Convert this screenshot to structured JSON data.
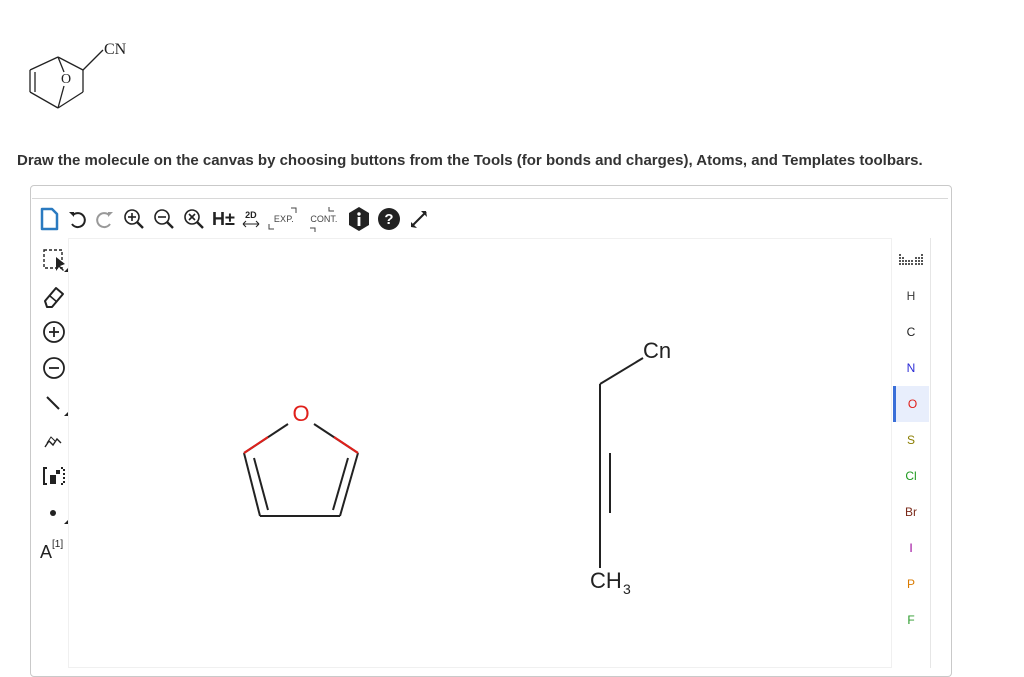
{
  "question": {
    "substituent_label": "CN",
    "ring_atom_label": "O"
  },
  "instruction": "Draw the molecule on the canvas by choosing buttons from the Tools (for bonds and charges), Atoms, and Templates toolbars.",
  "top_toolbar": {
    "hydrogen_label": "H±",
    "dim_label": "2D",
    "expand_label": "EXP.",
    "contract_label": "CONT."
  },
  "left_toolbar": {
    "atom_map_label": "A",
    "atom_map_index": "[1]"
  },
  "atoms": [
    {
      "symbol": "H",
      "color": "#3a3a3a"
    },
    {
      "symbol": "C",
      "color": "#222222"
    },
    {
      "symbol": "N",
      "color": "#2b2bd6"
    },
    {
      "symbol": "O",
      "color": "#e0201b"
    },
    {
      "symbol": "S",
      "color": "#8a7d00"
    },
    {
      "symbol": "Cl",
      "color": "#1f9a1f"
    },
    {
      "symbol": "Br",
      "color": "#7a2a1a"
    },
    {
      "symbol": "I",
      "color": "#9a009a"
    },
    {
      "symbol": "P",
      "color": "#d97a00"
    },
    {
      "symbol": "F",
      "color": "#2a9a2a"
    }
  ],
  "selected_atom": "O",
  "canvas": {
    "furan_o_label": "O",
    "chain_top_label": "Cn",
    "chain_bottom_label": "CH",
    "chain_bottom_sub": "3"
  },
  "colors": {
    "oxygen": "#e0201b",
    "bond": "#222222"
  }
}
